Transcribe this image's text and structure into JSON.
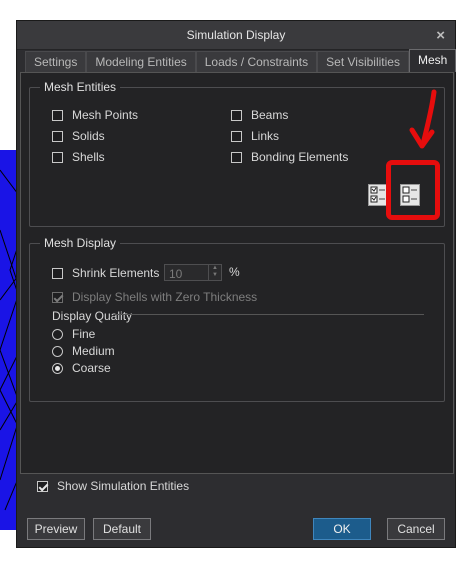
{
  "dialog": {
    "title": "Simulation Display",
    "close_glyph": "×"
  },
  "tabs": [
    {
      "label": "Settings",
      "active": false
    },
    {
      "label": "Modeling Entities",
      "active": false
    },
    {
      "label": "Loads / Constraints",
      "active": false
    },
    {
      "label": "Set Visibilities",
      "active": false
    },
    {
      "label": "Mesh",
      "active": true
    }
  ],
  "mesh_entities": {
    "title": "Mesh Entities",
    "items": [
      {
        "label": "Mesh Points",
        "checked": false
      },
      {
        "label": "Solids",
        "checked": false
      },
      {
        "label": "Shells",
        "checked": false
      },
      {
        "label": "Beams",
        "checked": false
      },
      {
        "label": "Links",
        "checked": false
      },
      {
        "label": "Bonding Elements",
        "checked": false
      }
    ],
    "icons": [
      "select-all-icon",
      "deselect-all-icon"
    ]
  },
  "mesh_display": {
    "title": "Mesh Display",
    "shrink_elements": {
      "label": "Shrink Elements",
      "checked": false,
      "value": "10",
      "unit": "%"
    },
    "zero_thickness": {
      "label": "Display Shells with Zero Thickness",
      "checked": true,
      "disabled": true
    },
    "display_quality": {
      "title": "Display Quality",
      "options": [
        {
          "label": "Fine",
          "selected": false
        },
        {
          "label": "Medium",
          "selected": false
        },
        {
          "label": "Coarse",
          "selected": true
        }
      ]
    }
  },
  "show_simulation_entities": {
    "label": "Show Simulation Entities",
    "checked": true
  },
  "footer": {
    "preview": "Preview",
    "default": "Default",
    "ok": "OK",
    "cancel": "Cancel"
  },
  "annotation": {
    "color": "#e60d0d"
  }
}
